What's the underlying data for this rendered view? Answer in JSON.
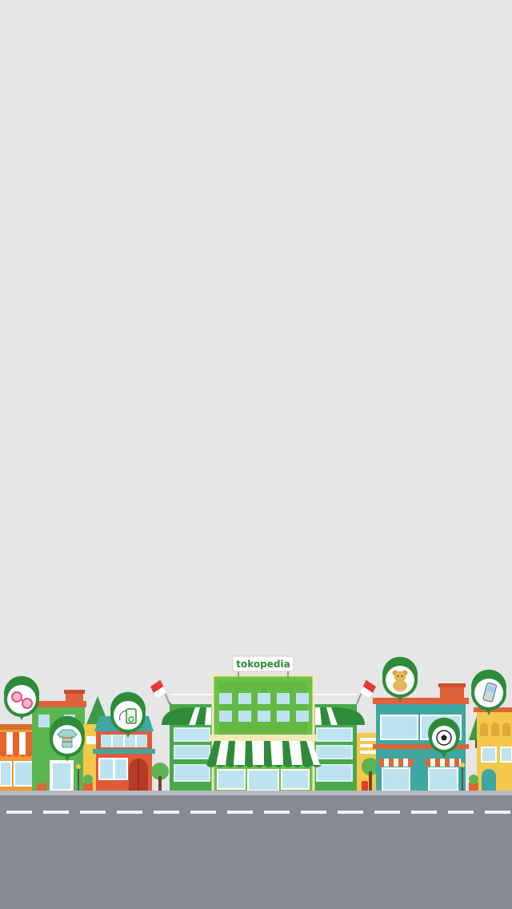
{
  "screen": {
    "background": "#e6e6e6",
    "type": "splash"
  },
  "brand": {
    "logo_text": "tokopedia",
    "primary_color": "#42b549",
    "dark_green": "#2e8b3a"
  },
  "road": {
    "color": "#878a94",
    "lane_mark_color": "#f2f2f2"
  },
  "shop_icons": [
    "glasses-icon",
    "sweater-icon",
    "ipod-icon",
    "teddy-bear-icon",
    "soccer-ball-icon",
    "mobile-phone-icon"
  ],
  "flags": [
    "indonesia-flag-left",
    "indonesia-flag-right"
  ]
}
